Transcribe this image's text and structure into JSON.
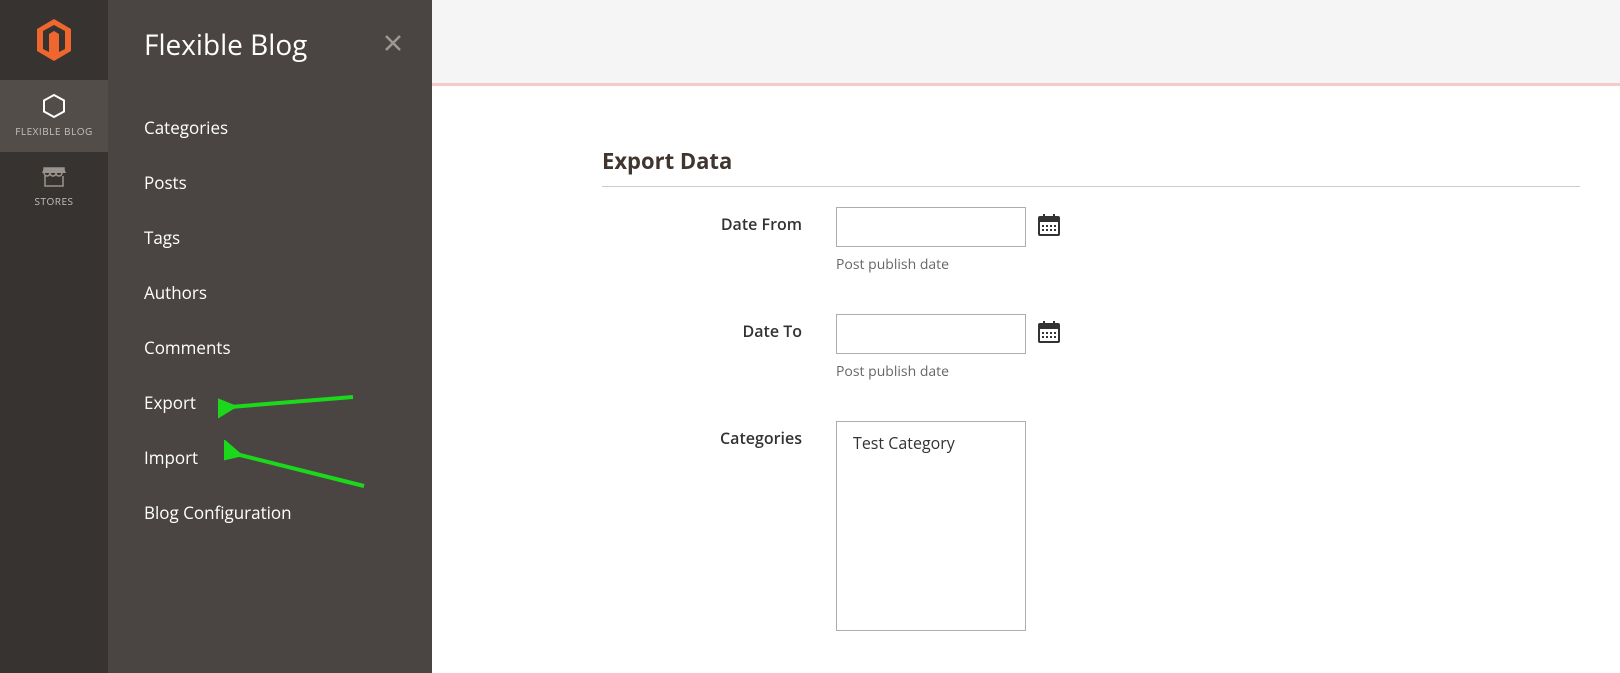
{
  "sidebar": {
    "items": [
      {
        "label": "FLEXIBLE BLOG"
      },
      {
        "label": "STORES"
      }
    ]
  },
  "flyout": {
    "title": "Flexible Blog",
    "items": [
      {
        "label": "Categories"
      },
      {
        "label": "Posts"
      },
      {
        "label": "Tags"
      },
      {
        "label": "Authors"
      },
      {
        "label": "Comments"
      },
      {
        "label": "Export"
      },
      {
        "label": "Import"
      },
      {
        "label": "Blog Configuration"
      }
    ]
  },
  "main": {
    "section_title": "Export Data",
    "fields": {
      "date_from": {
        "label": "Date From",
        "value": "",
        "hint": "Post publish date"
      },
      "date_to": {
        "label": "Date To",
        "value": "",
        "hint": "Post publish date"
      },
      "categories": {
        "label": "Categories",
        "options": [
          "Test Category"
        ]
      }
    }
  },
  "annotations": {
    "arrow_color": "#1bd81b"
  }
}
